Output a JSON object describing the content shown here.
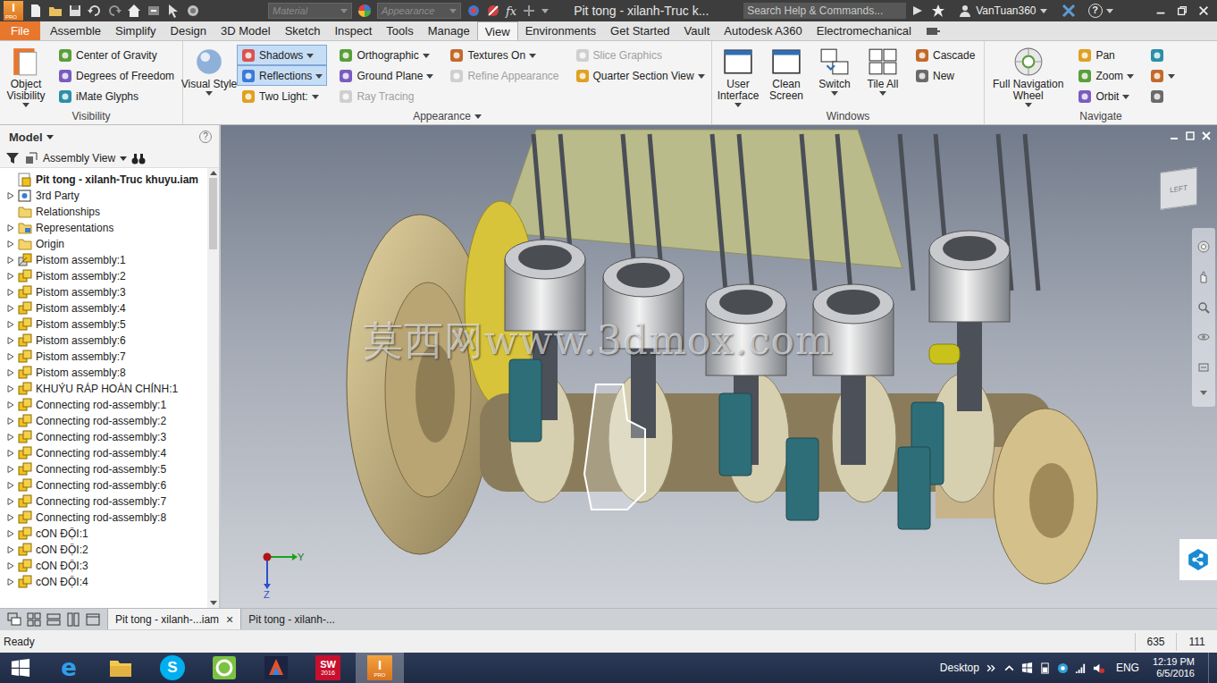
{
  "titlebar": {
    "logo": "I",
    "logo_badge": "PRO",
    "material": {
      "label": "Material",
      "disabled": true
    },
    "appearance": {
      "label": "Appearance",
      "disabled": true
    },
    "fx": "fx",
    "title": "Pit tong - xilanh-Truc k...",
    "search": "Search Help & Commands...",
    "user": "VanTuan360",
    "help": "?"
  },
  "ribbon_tabs": [
    {
      "label": "File",
      "selected": false,
      "kind": "file"
    },
    {
      "label": "Assemble",
      "selected": false,
      "kind": "tab"
    },
    {
      "label": "Simplify",
      "selected": false,
      "kind": "tab"
    },
    {
      "label": "Design",
      "selected": false,
      "kind": "tab"
    },
    {
      "label": "3D Model",
      "selected": false,
      "kind": "tab"
    },
    {
      "label": "Sketch",
      "selected": false,
      "kind": "tab"
    },
    {
      "label": "Inspect",
      "selected": false,
      "kind": "tab"
    },
    {
      "label": "Tools",
      "selected": false,
      "kind": "tab"
    },
    {
      "label": "Manage",
      "selected": false,
      "kind": "tab"
    },
    {
      "label": "View",
      "selected": true,
      "kind": "tab"
    },
    {
      "label": "Environments",
      "selected": false,
      "kind": "tab"
    },
    {
      "label": "Get Started",
      "selected": false,
      "kind": "tab"
    },
    {
      "label": "Vault",
      "selected": false,
      "kind": "tab"
    },
    {
      "label": "Autodesk A360",
      "selected": false,
      "kind": "tab"
    },
    {
      "label": "Electromechanical",
      "selected": false,
      "kind": "tab"
    }
  ],
  "ribbon_panels": [
    {
      "label": "Visibility",
      "dropdown": false,
      "groups": [
        {
          "kind": "large",
          "lines": [
            "Object",
            "Visibility"
          ],
          "dropdown": true,
          "toggled": false,
          "disabled": false
        },
        {
          "kind": "column",
          "buttons": [
            {
              "label": "Center of Gravity",
              "toggled": false,
              "disabled": false,
              "dropdown": false
            },
            {
              "label": "Degrees of Freedom",
              "toggled": false,
              "disabled": false,
              "dropdown": false
            },
            {
              "label": "iMate Glyphs",
              "toggled": false,
              "disabled": false,
              "dropdown": false
            }
          ]
        }
      ]
    },
    {
      "label": "Appearance",
      "dropdown": true,
      "groups": [
        {
          "kind": "large",
          "lines": [
            "Visual Style"
          ],
          "dropdown": true,
          "toggled": false,
          "disabled": false
        },
        {
          "kind": "column",
          "buttons": [
            {
              "label": "Shadows",
              "toggled": true,
              "disabled": false,
              "dropdown": true
            },
            {
              "label": "Reflections",
              "toggled": true,
              "disabled": false,
              "dropdown": true
            },
            {
              "label": "Two Light:",
              "toggled": false,
              "disabled": false,
              "dropdown": true
            }
          ]
        },
        {
          "kind": "column",
          "buttons": [
            {
              "label": "Orthographic",
              "toggled": false,
              "disabled": false,
              "dropdown": true
            },
            {
              "label": "Ground Plane",
              "toggled": false,
              "disabled": false,
              "dropdown": true
            },
            {
              "label": "Ray Tracing",
              "toggled": false,
              "disabled": true,
              "dropdown": false
            }
          ]
        },
        {
          "kind": "column",
          "buttons": [
            {
              "label": "Textures On",
              "toggled": false,
              "disabled": false,
              "dropdown": true
            },
            {
              "label": "Refine Appearance",
              "toggled": false,
              "disabled": true,
              "dropdown": false
            }
          ]
        },
        {
          "kind": "column",
          "buttons": [
            {
              "label": "Slice Graphics",
              "toggled": false,
              "disabled": true,
              "dropdown": false
            },
            {
              "label": "Quarter Section View",
              "toggled": false,
              "disabled": false,
              "dropdown": true
            }
          ]
        }
      ]
    },
    {
      "label": "Windows",
      "dropdown": false,
      "groups": [
        {
          "kind": "large",
          "lines": [
            "User",
            "Interface"
          ],
          "dropdown": true,
          "toggled": false,
          "disabled": false
        },
        {
          "kind": "large",
          "lines": [
            "Clean",
            "Screen"
          ],
          "dropdown": false,
          "toggled": false,
          "disabled": false
        },
        {
          "kind": "large",
          "lines": [
            "Switch"
          ],
          "dropdown": true,
          "toggled": false,
          "disabled": false
        },
        {
          "kind": "large",
          "lines": [
            "Tile All"
          ],
          "dropdown": true,
          "toggled": false,
          "disabled": false
        },
        {
          "kind": "column",
          "buttons": [
            {
              "label": "Cascade",
              "toggled": false,
              "disabled": false,
              "dropdown": false
            },
            {
              "label": "New",
              "toggled": false,
              "disabled": false,
              "dropdown": false
            }
          ]
        }
      ]
    },
    {
      "label": "Navigate",
      "dropdown": false,
      "groups": [
        {
          "kind": "large",
          "lines": [
            "Full Navigation",
            "Wheel"
          ],
          "dropdown": true,
          "toggled": false,
          "disabled": false
        },
        {
          "kind": "column",
          "buttons": [
            {
              "label": "Pan",
              "toggled": false,
              "disabled": false,
              "dropdown": false
            },
            {
              "label": "Zoom",
              "toggled": false,
              "disabled": false,
              "dropdown": true
            },
            {
              "label": "Orbit",
              "toggled": false,
              "disabled": false,
              "dropdown": true
            }
          ]
        },
        {
          "kind": "column",
          "buttons": [
            {
              "toggled": false,
              "disabled": false,
              "dropdown": false
            },
            {
              "toggled": false,
              "disabled": false,
              "dropdown": true
            },
            {
              "toggled": false,
              "disabled": false,
              "dropdown": false
            }
          ]
        }
      ]
    }
  ],
  "browser": {
    "title": "Model",
    "help": "?",
    "view": "Assembly View",
    "items": [
      {
        "label": "Pit tong - xilanh-Truc khuyu.iam",
        "kind": "root",
        "level": 0,
        "expandable": false
      },
      {
        "label": "3rd Party",
        "kind": "party",
        "level": 1,
        "expandable": true
      },
      {
        "label": "Relationships",
        "kind": "folder",
        "level": 1,
        "expandable": false
      },
      {
        "label": "Representations",
        "kind": "reps",
        "level": 1,
        "expandable": true
      },
      {
        "label": "Origin",
        "kind": "folder",
        "level": 1,
        "expandable": true
      },
      {
        "label": "Pistom assembly:1",
        "kind": "assembly-alt",
        "level": 1,
        "expandable": true
      },
      {
        "label": "Pistom assembly:2",
        "kind": "assembly",
        "level": 1,
        "expandable": true
      },
      {
        "label": "Pistom assembly:3",
        "kind": "assembly",
        "level": 1,
        "expandable": true
      },
      {
        "label": "Pistom assembly:4",
        "kind": "assembly",
        "level": 1,
        "expandable": true
      },
      {
        "label": "Pistom assembly:5",
        "kind": "assembly",
        "level": 1,
        "expandable": true
      },
      {
        "label": "Pistom assembly:6",
        "kind": "assembly",
        "level": 1,
        "expandable": true
      },
      {
        "label": "Pistom assembly:7",
        "kind": "assembly",
        "level": 1,
        "expandable": true
      },
      {
        "label": "Pistom assembly:8",
        "kind": "assembly",
        "level": 1,
        "expandable": true
      },
      {
        "label": "KHUỶU RÁP HOÀN CHỈNH:1",
        "kind": "assembly",
        "level": 1,
        "expandable": true
      },
      {
        "label": "Connecting rod-assembly:1",
        "kind": "assembly",
        "level": 1,
        "expandable": true
      },
      {
        "label": "Connecting rod-assembly:2",
        "kind": "assembly",
        "level": 1,
        "expandable": true
      },
      {
        "label": "Connecting rod-assembly:3",
        "kind": "assembly",
        "level": 1,
        "expandable": true
      },
      {
        "label": "Connecting rod-assembly:4",
        "kind": "assembly",
        "level": 1,
        "expandable": true
      },
      {
        "label": "Connecting rod-assembly:5",
        "kind": "assembly",
        "level": 1,
        "expandable": true
      },
      {
        "label": "Connecting rod-assembly:6",
        "kind": "assembly",
        "level": 1,
        "expandable": true
      },
      {
        "label": "Connecting rod-assembly:7",
        "kind": "assembly",
        "level": 1,
        "expandable": true
      },
      {
        "label": "Connecting rod-assembly:8",
        "kind": "assembly",
        "level": 1,
        "expandable": true
      },
      {
        "label": "cON ĐỘI:1",
        "kind": "assembly",
        "level": 1,
        "expandable": true
      },
      {
        "label": "cON ĐỘI:2",
        "kind": "assembly",
        "level": 1,
        "expandable": true
      },
      {
        "label": "cON ĐỘI:3",
        "kind": "assembly",
        "level": 1,
        "expandable": true
      },
      {
        "label": "cON ĐỘI:4",
        "kind": "assembly",
        "level": 1,
        "expandable": true
      }
    ]
  },
  "viewport": {
    "watermark": "莫西网www.3dmox.com",
    "viewcube": "LEFT",
    "axes": [
      "Y",
      "Z"
    ]
  },
  "doc_tabs": [
    {
      "label": "Pit tong - xilanh-...iam",
      "selected": true,
      "close": "×"
    },
    {
      "label": "Pit tong - xilanh-...",
      "selected": false
    }
  ],
  "status_bar": {
    "text": "Ready",
    "values": [
      "635",
      "111"
    ]
  },
  "taskbar": {
    "apps": [
      {
        "kind": "ie",
        "glyph": "e",
        "selected": false
      },
      {
        "kind": "explorer",
        "selected": false
      },
      {
        "kind": "skype",
        "glyph": "S",
        "selected": false
      },
      {
        "kind": "greenapp",
        "selected": false
      },
      {
        "kind": "flash",
        "selected": false
      },
      {
        "kind": "solidworks",
        "glyph": "SW",
        "badge": "2016",
        "selected": false
      },
      {
        "kind": "inventor",
        "glyph": "I",
        "badge": "PRO",
        "selected": true
      }
    ],
    "desktop": "Desktop",
    "language": "ENG",
    "time": "12:19 PM",
    "date": "6/5/2016"
  }
}
